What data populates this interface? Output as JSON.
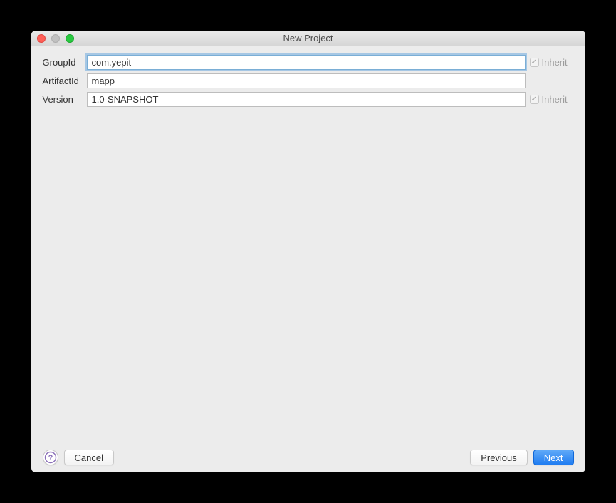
{
  "window": {
    "title": "New Project"
  },
  "form": {
    "groupid_label": "GroupId",
    "groupid_value": "com.yepit",
    "artifactid_label": "ArtifactId",
    "artifactid_value": "mapp",
    "version_label": "Version",
    "version_value": "1.0-SNAPSHOT",
    "inherit_label": "Inherit",
    "inherit_check_glyph": "✓"
  },
  "footer": {
    "help_label": "?",
    "cancel": "Cancel",
    "previous": "Previous",
    "next": "Next"
  }
}
